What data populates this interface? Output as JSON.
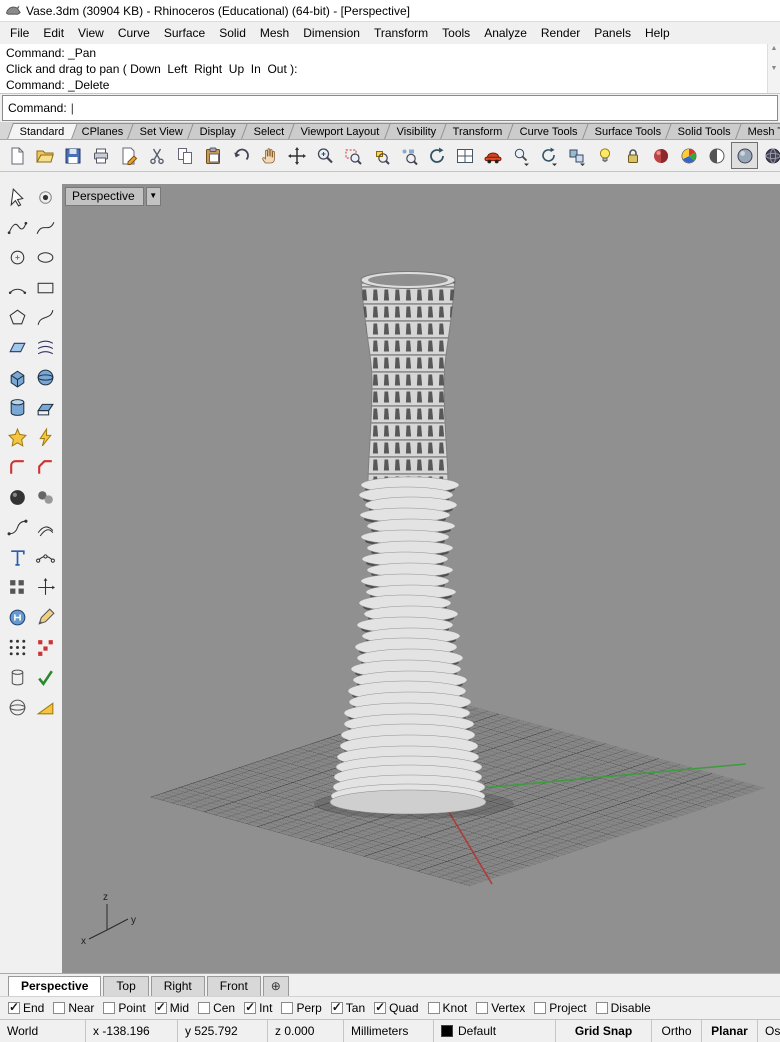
{
  "window": {
    "title": "Vase.3dm (30904 KB) - Rhinoceros (Educational) (64-bit) - [Perspective]"
  },
  "menu": {
    "items": [
      "File",
      "Edit",
      "View",
      "Curve",
      "Surface",
      "Solid",
      "Mesh",
      "Dimension",
      "Transform",
      "Tools",
      "Analyze",
      "Render",
      "Panels",
      "Help"
    ]
  },
  "command": {
    "history": [
      "Command: _Pan",
      "Click and drag to pan ( Down  Left  Right  Up  In  Out ):",
      "Command: _Delete"
    ],
    "prompt": "Command:",
    "value": "",
    "caret": "|"
  },
  "toolbar": {
    "tabs": [
      "Standard",
      "CPlanes",
      "Set View",
      "Display",
      "Select",
      "Viewport Layout",
      "Visibility",
      "Transform",
      "Curve Tools",
      "Surface Tools",
      "Solid Tools",
      "Mesh Tools"
    ],
    "active_tab": "Standard",
    "icons": [
      "new-file",
      "open-file",
      "save-file",
      "print",
      "properties",
      "cut",
      "copy",
      "paste",
      "undo",
      "pan-view",
      "move-view",
      "zoom-dynamic",
      "zoom-window",
      "zoom-selected",
      "zoom-extents",
      "rotate-view",
      "viewport-layout",
      "render",
      "zoom-flyout",
      "view-flyout",
      "cplane-flyout",
      "lights",
      "lock",
      "display-rendered",
      "display-color",
      "display-ghosted",
      "display-shaded",
      "display-wireframe"
    ]
  },
  "sidebar": {
    "tools": [
      "select",
      "point",
      "control-point-curve",
      "interpolate-curve",
      "circle",
      "ellipse",
      "arc",
      "rectangle",
      "polygon",
      "freeform-curve",
      "plane-surface",
      "loft",
      "box",
      "sphere",
      "cylinder",
      "extrude-surface",
      "boolean-union",
      "boolean-difference",
      "fillet",
      "chamfer",
      "render-sphere",
      "blend-spheres",
      "blend-curve",
      "offset-curve",
      "text-object",
      "edit-points",
      "array-rect",
      "move-axis",
      "material",
      "pencil-edit",
      "array-points",
      "array-polar",
      "pipe",
      "check-geometry",
      "sphere-outline",
      "wedge"
    ]
  },
  "viewport": {
    "title": "Perspective",
    "dropdown_caret": "▼",
    "tabs": [
      "Perspective",
      "Top",
      "Right",
      "Front"
    ],
    "active_tab": "Perspective",
    "new_tab_label": "⊕",
    "axis": {
      "x": "x",
      "y": "y",
      "z": "z"
    }
  },
  "osnap": {
    "items": [
      {
        "label": "End",
        "checked": true
      },
      {
        "label": "Near",
        "checked": false
      },
      {
        "label": "Point",
        "checked": false
      },
      {
        "label": "Mid",
        "checked": true
      },
      {
        "label": "Cen",
        "checked": false
      },
      {
        "label": "Int",
        "checked": true
      },
      {
        "label": "Perp",
        "checked": false
      },
      {
        "label": "Tan",
        "checked": true
      },
      {
        "label": "Quad",
        "checked": true
      },
      {
        "label": "Knot",
        "checked": false
      },
      {
        "label": "Vertex",
        "checked": false
      },
      {
        "label": "Project",
        "checked": false
      },
      {
        "label": "Disable",
        "checked": false
      }
    ]
  },
  "status": {
    "cplane": "World",
    "x": "x -138.196",
    "y": "y 525.792",
    "z": "z 0.000",
    "units": "Millimeters",
    "layer": "Default",
    "toggles": [
      {
        "label": "Grid Snap",
        "active": true
      },
      {
        "label": "Ortho",
        "active": false
      },
      {
        "label": "Planar",
        "active": true
      },
      {
        "label": "Osnap",
        "active": false
      }
    ]
  },
  "colors": {
    "viewport_bg": "#909090",
    "x_axis": "#b03a3a",
    "y_axis": "#3f9b3f",
    "layer_swatch": "#000000"
  }
}
